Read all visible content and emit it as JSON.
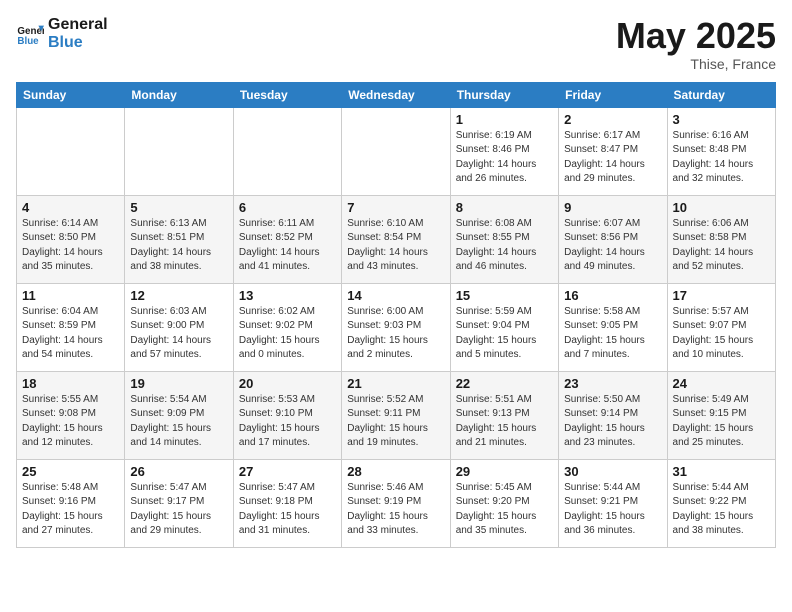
{
  "header": {
    "logo_line1": "General",
    "logo_line2": "Blue",
    "month": "May 2025",
    "location": "Thise, France"
  },
  "days_of_week": [
    "Sunday",
    "Monday",
    "Tuesday",
    "Wednesday",
    "Thursday",
    "Friday",
    "Saturday"
  ],
  "weeks": [
    [
      {
        "day": "",
        "info": ""
      },
      {
        "day": "",
        "info": ""
      },
      {
        "day": "",
        "info": ""
      },
      {
        "day": "",
        "info": ""
      },
      {
        "day": "1",
        "info": "Sunrise: 6:19 AM\nSunset: 8:46 PM\nDaylight: 14 hours\nand 26 minutes."
      },
      {
        "day": "2",
        "info": "Sunrise: 6:17 AM\nSunset: 8:47 PM\nDaylight: 14 hours\nand 29 minutes."
      },
      {
        "day": "3",
        "info": "Sunrise: 6:16 AM\nSunset: 8:48 PM\nDaylight: 14 hours\nand 32 minutes."
      }
    ],
    [
      {
        "day": "4",
        "info": "Sunrise: 6:14 AM\nSunset: 8:50 PM\nDaylight: 14 hours\nand 35 minutes."
      },
      {
        "day": "5",
        "info": "Sunrise: 6:13 AM\nSunset: 8:51 PM\nDaylight: 14 hours\nand 38 minutes."
      },
      {
        "day": "6",
        "info": "Sunrise: 6:11 AM\nSunset: 8:52 PM\nDaylight: 14 hours\nand 41 minutes."
      },
      {
        "day": "7",
        "info": "Sunrise: 6:10 AM\nSunset: 8:54 PM\nDaylight: 14 hours\nand 43 minutes."
      },
      {
        "day": "8",
        "info": "Sunrise: 6:08 AM\nSunset: 8:55 PM\nDaylight: 14 hours\nand 46 minutes."
      },
      {
        "day": "9",
        "info": "Sunrise: 6:07 AM\nSunset: 8:56 PM\nDaylight: 14 hours\nand 49 minutes."
      },
      {
        "day": "10",
        "info": "Sunrise: 6:06 AM\nSunset: 8:58 PM\nDaylight: 14 hours\nand 52 minutes."
      }
    ],
    [
      {
        "day": "11",
        "info": "Sunrise: 6:04 AM\nSunset: 8:59 PM\nDaylight: 14 hours\nand 54 minutes."
      },
      {
        "day": "12",
        "info": "Sunrise: 6:03 AM\nSunset: 9:00 PM\nDaylight: 14 hours\nand 57 minutes."
      },
      {
        "day": "13",
        "info": "Sunrise: 6:02 AM\nSunset: 9:02 PM\nDaylight: 15 hours\nand 0 minutes."
      },
      {
        "day": "14",
        "info": "Sunrise: 6:00 AM\nSunset: 9:03 PM\nDaylight: 15 hours\nand 2 minutes."
      },
      {
        "day": "15",
        "info": "Sunrise: 5:59 AM\nSunset: 9:04 PM\nDaylight: 15 hours\nand 5 minutes."
      },
      {
        "day": "16",
        "info": "Sunrise: 5:58 AM\nSunset: 9:05 PM\nDaylight: 15 hours\nand 7 minutes."
      },
      {
        "day": "17",
        "info": "Sunrise: 5:57 AM\nSunset: 9:07 PM\nDaylight: 15 hours\nand 10 minutes."
      }
    ],
    [
      {
        "day": "18",
        "info": "Sunrise: 5:55 AM\nSunset: 9:08 PM\nDaylight: 15 hours\nand 12 minutes."
      },
      {
        "day": "19",
        "info": "Sunrise: 5:54 AM\nSunset: 9:09 PM\nDaylight: 15 hours\nand 14 minutes."
      },
      {
        "day": "20",
        "info": "Sunrise: 5:53 AM\nSunset: 9:10 PM\nDaylight: 15 hours\nand 17 minutes."
      },
      {
        "day": "21",
        "info": "Sunrise: 5:52 AM\nSunset: 9:11 PM\nDaylight: 15 hours\nand 19 minutes."
      },
      {
        "day": "22",
        "info": "Sunrise: 5:51 AM\nSunset: 9:13 PM\nDaylight: 15 hours\nand 21 minutes."
      },
      {
        "day": "23",
        "info": "Sunrise: 5:50 AM\nSunset: 9:14 PM\nDaylight: 15 hours\nand 23 minutes."
      },
      {
        "day": "24",
        "info": "Sunrise: 5:49 AM\nSunset: 9:15 PM\nDaylight: 15 hours\nand 25 minutes."
      }
    ],
    [
      {
        "day": "25",
        "info": "Sunrise: 5:48 AM\nSunset: 9:16 PM\nDaylight: 15 hours\nand 27 minutes."
      },
      {
        "day": "26",
        "info": "Sunrise: 5:47 AM\nSunset: 9:17 PM\nDaylight: 15 hours\nand 29 minutes."
      },
      {
        "day": "27",
        "info": "Sunrise: 5:47 AM\nSunset: 9:18 PM\nDaylight: 15 hours\nand 31 minutes."
      },
      {
        "day": "28",
        "info": "Sunrise: 5:46 AM\nSunset: 9:19 PM\nDaylight: 15 hours\nand 33 minutes."
      },
      {
        "day": "29",
        "info": "Sunrise: 5:45 AM\nSunset: 9:20 PM\nDaylight: 15 hours\nand 35 minutes."
      },
      {
        "day": "30",
        "info": "Sunrise: 5:44 AM\nSunset: 9:21 PM\nDaylight: 15 hours\nand 36 minutes."
      },
      {
        "day": "31",
        "info": "Sunrise: 5:44 AM\nSunset: 9:22 PM\nDaylight: 15 hours\nand 38 minutes."
      }
    ]
  ]
}
